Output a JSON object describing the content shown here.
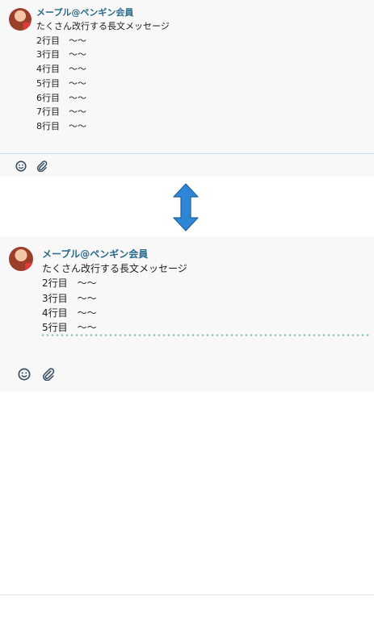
{
  "top": {
    "sender": "メープル@ペンギン会員",
    "lines": [
      "たくさん改行する長文メッセージ",
      "2行目　〜〜",
      "3行目　〜〜",
      "4行目　〜〜",
      "5行目　〜〜",
      "6行目　〜〜",
      "7行目　〜〜",
      "8行目　〜〜"
    ]
  },
  "bottom": {
    "sender": "メープル@ペンギン会員",
    "lines": [
      "たくさん改行する長文メッセージ",
      "2行目　〜〜",
      "3行目　〜〜",
      "4行目　〜〜",
      "5行目　〜〜"
    ]
  },
  "icons": {
    "emoji": "emoji-icon",
    "attach": "paperclip-icon",
    "arrow": "double-arrow-icon"
  },
  "colors": {
    "sender": "#2a6a8a",
    "arrow": "#2e86d6",
    "truncate_dots": "#8fc7b5"
  }
}
